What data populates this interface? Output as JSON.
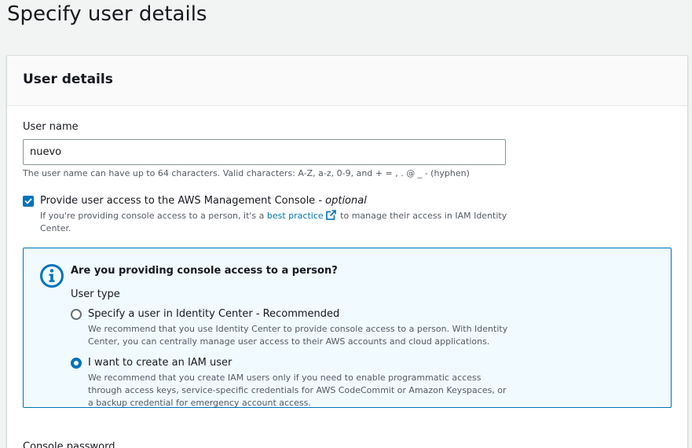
{
  "page": {
    "title": "Specify user details"
  },
  "panel": {
    "title": "User details",
    "user_name": {
      "label": "User name",
      "value": "nuevo",
      "hint": "The user name can have up to 64 characters. Valid characters: A-Z, a-z, 0-9, and + = , . @ _ - (hyphen)"
    },
    "console_access": {
      "checked": true,
      "label": "Provide user access to the AWS Management Console - ",
      "optional": "optional",
      "desc_before": "If you're providing console access to a person, it's a ",
      "desc_link": "best practice",
      "desc_after": " to manage their access in IAM Identity Center."
    },
    "info": {
      "title": "Are you providing console access to a person?",
      "user_type_label": "User type",
      "options": [
        {
          "label": "Specify a user in Identity Center - Recommended",
          "desc": "We recommend that you use Identity Center to provide console access to a person. With Identity Center, you can centrally manage user access to their AWS accounts and cloud applications.",
          "selected": false
        },
        {
          "label": "I want to create an IAM user",
          "desc": "We recommend that you create IAM users only if you need to enable programmatic access through access keys, service-specific credentials for AWS CodeCommit or Amazon Keyspaces, or a backup credential for emergency account access.",
          "selected": true
        }
      ]
    },
    "next_field_label": "Console password"
  },
  "colors": {
    "accent": "#0073bb",
    "info_bg": "#f1faff",
    "text": "#16191f",
    "muted": "#545b64"
  },
  "icons": [
    "check-icon",
    "external-link-icon",
    "info-icon"
  ]
}
